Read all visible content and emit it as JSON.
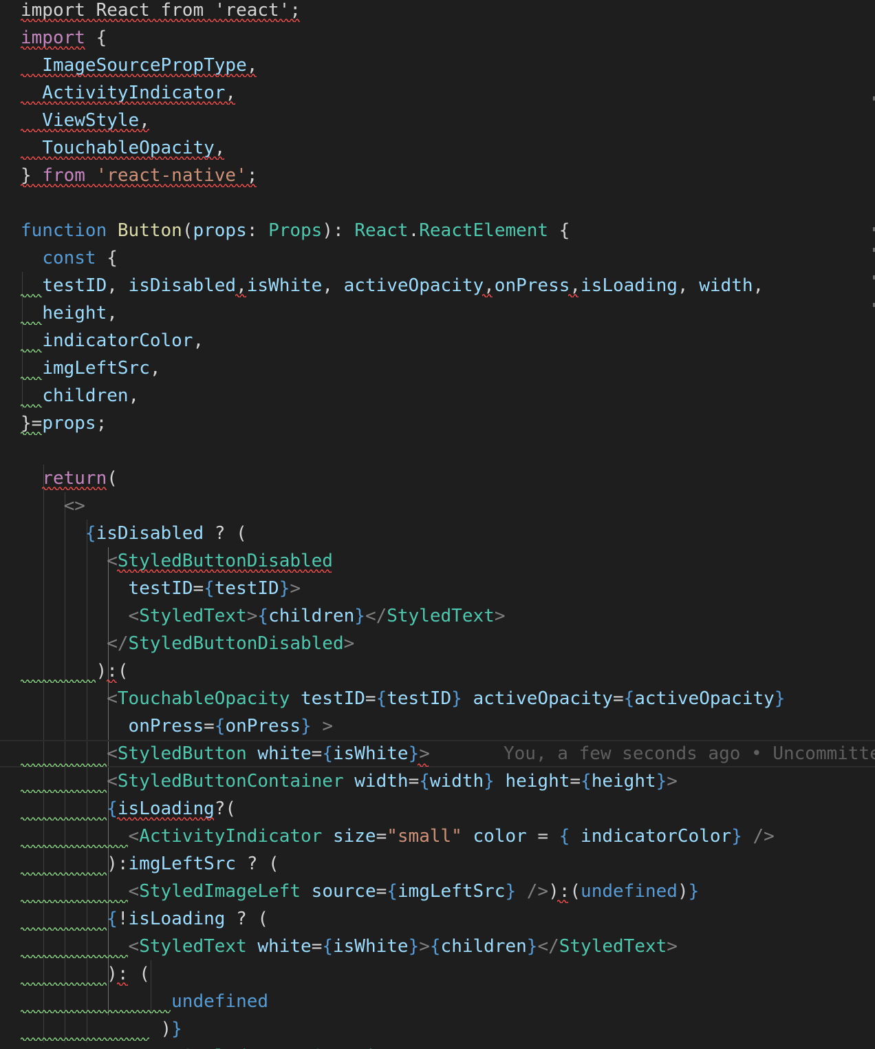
{
  "editor": {
    "colors": {
      "background": "#1e1e1e",
      "text": "#d4d4d4",
      "keyword_control": "#c586c0",
      "keyword_storage": "#569cd6",
      "function": "#dcdcaa",
      "type": "#4ec9b0",
      "variable": "#9cdcfe",
      "string": "#ce9178",
      "tag_bracket": "#808080",
      "blame": "#5f5f5f",
      "error_squiggle": "#f14c4c",
      "warning_squiggle": "#89d185"
    },
    "blame": "You, a few seconds ago • Uncommitte",
    "lines": [
      [
        [
          "import React from 'react';",
          "text"
        ]
      ],
      [
        [
          "import",
          "kw"
        ],
        [
          " {",
          "t"
        ]
      ],
      [
        [
          "  ImageSourcePropType",
          "var"
        ],
        [
          ",",
          "t"
        ]
      ],
      [
        [
          "  ActivityIndicator",
          "var"
        ],
        [
          ",",
          "t"
        ]
      ],
      [
        [
          "  ViewStyle",
          "var"
        ],
        [
          ",",
          "t"
        ]
      ],
      [
        [
          "  TouchableOpacity",
          "var"
        ],
        [
          ",",
          "t"
        ]
      ],
      [
        [
          "} ",
          "t"
        ],
        [
          "from",
          "kw"
        ],
        [
          " ",
          "t"
        ],
        [
          "'react-native'",
          "str"
        ],
        [
          ";",
          "t"
        ]
      ],
      [],
      [
        [
          "function",
          "stor"
        ],
        [
          " ",
          "t"
        ],
        [
          "Button",
          "fn"
        ],
        [
          "(",
          "t"
        ],
        [
          "props",
          "var"
        ],
        [
          ": ",
          "t"
        ],
        [
          "Props",
          "type"
        ],
        [
          "): ",
          "t"
        ],
        [
          "React",
          "type"
        ],
        [
          ".",
          "t"
        ],
        [
          "ReactElement",
          "type"
        ],
        [
          " {",
          "t"
        ]
      ],
      [
        [
          "  ",
          "t"
        ],
        [
          "const",
          "stor"
        ],
        [
          " {",
          "t"
        ]
      ],
      [
        [
          "  ",
          "t"
        ],
        [
          "testID",
          "var"
        ],
        [
          ", ",
          "t"
        ],
        [
          "isDisabled",
          "var"
        ],
        [
          ",",
          "t"
        ],
        [
          "isWhite",
          "var"
        ],
        [
          ", ",
          "t"
        ],
        [
          "activeOpacity",
          "var"
        ],
        [
          ",",
          "t"
        ],
        [
          "onPress",
          "var"
        ],
        [
          ",",
          "t"
        ],
        [
          "isLoading",
          "var"
        ],
        [
          ", ",
          "t"
        ],
        [
          "width",
          "var"
        ],
        [
          ",",
          "t"
        ]
      ],
      [
        [
          "  ",
          "t"
        ],
        [
          "height",
          "var"
        ],
        [
          ",",
          "t"
        ]
      ],
      [
        [
          "  ",
          "t"
        ],
        [
          "indicatorColor",
          "var"
        ],
        [
          ",",
          "t"
        ]
      ],
      [
        [
          "  ",
          "t"
        ],
        [
          "imgLeftSrc",
          "var"
        ],
        [
          ",",
          "t"
        ]
      ],
      [
        [
          "  ",
          "t"
        ],
        [
          "children",
          "var"
        ],
        [
          ",",
          "t"
        ]
      ],
      [
        [
          "}=",
          "t"
        ],
        [
          "props",
          "var"
        ],
        [
          ";",
          "t"
        ]
      ],
      [],
      [
        [
          "  ",
          "t"
        ],
        [
          "return",
          "kw"
        ],
        [
          "(",
          "t"
        ]
      ],
      [
        [
          "    ",
          "t"
        ],
        [
          "<>",
          "tag"
        ]
      ],
      [
        [
          "      ",
          "t"
        ],
        [
          "{",
          "brace"
        ],
        [
          "isDisabled",
          "var"
        ],
        [
          " ? (",
          "t"
        ]
      ],
      [
        [
          "        ",
          "t"
        ],
        [
          "<",
          "tag"
        ],
        [
          "StyledButtonDisabled",
          "type"
        ]
      ],
      [
        [
          "          ",
          "t"
        ],
        [
          "testID",
          "var"
        ],
        [
          "=",
          "t"
        ],
        [
          "{",
          "brace"
        ],
        [
          "testID",
          "var"
        ],
        [
          "}",
          "brace"
        ],
        [
          ">",
          "tag"
        ]
      ],
      [
        [
          "          ",
          "t"
        ],
        [
          "<",
          "tag"
        ],
        [
          "StyledText",
          "type"
        ],
        [
          ">",
          "tag"
        ],
        [
          "{",
          "brace"
        ],
        [
          "children",
          "var"
        ],
        [
          "}",
          "brace"
        ],
        [
          "</",
          "tag"
        ],
        [
          "StyledText",
          "type"
        ],
        [
          ">",
          "tag"
        ]
      ],
      [
        [
          "        ",
          "t"
        ],
        [
          "</",
          "tag"
        ],
        [
          "StyledButtonDisabled",
          "type"
        ],
        [
          ">",
          "tag"
        ]
      ],
      [
        [
          "       ",
          "t"
        ],
        [
          "):(",
          "t"
        ]
      ],
      [
        [
          "        ",
          "t"
        ],
        [
          "<",
          "tag"
        ],
        [
          "TouchableOpacity",
          "type"
        ],
        [
          " ",
          "t"
        ],
        [
          "testID",
          "var"
        ],
        [
          "=",
          "t"
        ],
        [
          "{",
          "brace"
        ],
        [
          "testID",
          "var"
        ],
        [
          "}",
          "brace"
        ],
        [
          " ",
          "t"
        ],
        [
          "activeOpacity",
          "var"
        ],
        [
          "=",
          "t"
        ],
        [
          "{",
          "brace"
        ],
        [
          "activeOpacity",
          "var"
        ],
        [
          "}",
          "brace"
        ]
      ],
      [
        [
          "          ",
          "t"
        ],
        [
          "onPress",
          "var"
        ],
        [
          "=",
          "t"
        ],
        [
          "{",
          "brace"
        ],
        [
          "onPress",
          "var"
        ],
        [
          "}",
          "brace"
        ],
        [
          " ",
          "t"
        ],
        [
          ">",
          "tag"
        ]
      ],
      [
        [
          "        ",
          "t"
        ],
        [
          "<",
          "tag"
        ],
        [
          "StyledButton",
          "type"
        ],
        [
          " ",
          "t"
        ],
        [
          "white",
          "var"
        ],
        [
          "=",
          "t"
        ],
        [
          "{",
          "brace"
        ],
        [
          "isWhite",
          "var"
        ],
        [
          "}",
          "brace"
        ],
        [
          ">",
          "tag"
        ]
      ],
      [
        [
          "        ",
          "t"
        ],
        [
          "<",
          "tag"
        ],
        [
          "StyledButtonContainer",
          "type"
        ],
        [
          " ",
          "t"
        ],
        [
          "width",
          "var"
        ],
        [
          "=",
          "t"
        ],
        [
          "{",
          "brace"
        ],
        [
          "width",
          "var"
        ],
        [
          "}",
          "brace"
        ],
        [
          " ",
          "t"
        ],
        [
          "height",
          "var"
        ],
        [
          "=",
          "t"
        ],
        [
          "{",
          "brace"
        ],
        [
          "height",
          "var"
        ],
        [
          "}",
          "brace"
        ],
        [
          ">",
          "tag"
        ]
      ],
      [
        [
          "        ",
          "t"
        ],
        [
          "{",
          "brace"
        ],
        [
          "isLoading",
          "var"
        ],
        [
          "?(",
          "t"
        ]
      ],
      [
        [
          "          ",
          "t"
        ],
        [
          "<",
          "tag"
        ],
        [
          "ActivityIndicator",
          "type"
        ],
        [
          " ",
          "t"
        ],
        [
          "size",
          "var"
        ],
        [
          "=",
          "t"
        ],
        [
          "\"small\"",
          "str"
        ],
        [
          " ",
          "t"
        ],
        [
          "color",
          "var"
        ],
        [
          " = ",
          "t"
        ],
        [
          "{",
          "brace"
        ],
        [
          " ",
          "t"
        ],
        [
          "indicatorColor",
          "var"
        ],
        [
          "}",
          "brace"
        ],
        [
          " ",
          "t"
        ],
        [
          "/>",
          "tag"
        ]
      ],
      [
        [
          "        ",
          "t"
        ],
        [
          "):",
          "t"
        ],
        [
          "imgLeftSrc",
          "var"
        ],
        [
          " ? (",
          "t"
        ]
      ],
      [
        [
          "          ",
          "t"
        ],
        [
          "<",
          "tag"
        ],
        [
          "StyledImageLeft",
          "type"
        ],
        [
          " ",
          "t"
        ],
        [
          "source",
          "var"
        ],
        [
          "=",
          "t"
        ],
        [
          "{",
          "brace"
        ],
        [
          "imgLeftSrc",
          "var"
        ],
        [
          "}",
          "brace"
        ],
        [
          " ",
          "t"
        ],
        [
          "/>",
          "tag"
        ],
        [
          "):(",
          "t"
        ],
        [
          "undefined",
          "stor"
        ],
        [
          ")",
          "t"
        ],
        [
          "}",
          "brace"
        ]
      ],
      [
        [
          "        ",
          "t"
        ],
        [
          "{",
          "brace"
        ],
        [
          "!",
          "t"
        ],
        [
          "isLoading",
          "var"
        ],
        [
          " ? (",
          "t"
        ]
      ],
      [
        [
          "          ",
          "t"
        ],
        [
          "<",
          "tag"
        ],
        [
          "StyledText",
          "type"
        ],
        [
          " ",
          "t"
        ],
        [
          "white",
          "var"
        ],
        [
          "=",
          "t"
        ],
        [
          "{",
          "brace"
        ],
        [
          "isWhite",
          "var"
        ],
        [
          "}",
          "brace"
        ],
        [
          ">",
          "tag"
        ],
        [
          "{",
          "brace"
        ],
        [
          "children",
          "var"
        ],
        [
          "}",
          "brace"
        ],
        [
          "</",
          "tag"
        ],
        [
          "StyledText",
          "type"
        ],
        [
          ">",
          "tag"
        ]
      ],
      [
        [
          "        ",
          "t"
        ],
        [
          "): (",
          "t"
        ]
      ],
      [
        [
          "              ",
          "t"
        ],
        [
          "undefined",
          "stor"
        ]
      ],
      [
        [
          "             ",
          "t"
        ],
        [
          ")",
          "t"
        ],
        [
          "}",
          "brace"
        ]
      ],
      [
        [
          "             ",
          "t"
        ],
        [
          "</",
          "tag"
        ],
        [
          "StyledButtonContainer",
          "type"
        ],
        [
          ">",
          "tag"
        ]
      ]
    ]
  }
}
